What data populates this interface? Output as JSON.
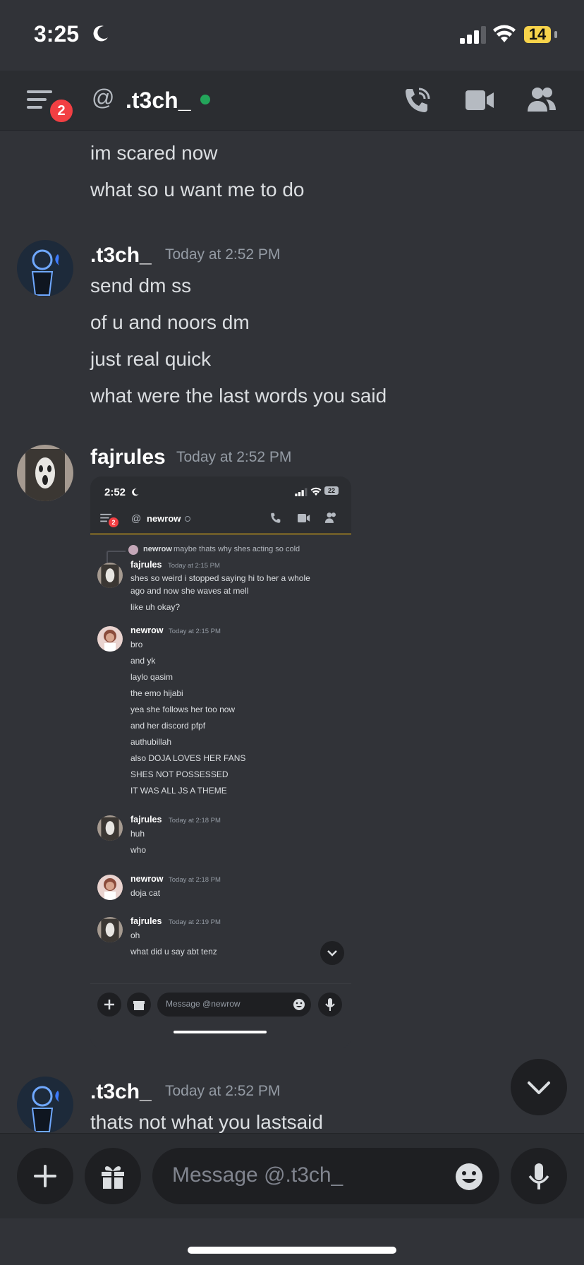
{
  "status_bar": {
    "time": "3:25",
    "battery": "14"
  },
  "header": {
    "at": "@",
    "channel": ".t3ch_",
    "badge": "2"
  },
  "messages": {
    "cont1": "im scared now",
    "cont2": "what so u want me to do",
    "g1": {
      "author": ".t3ch_",
      "time": "Today at 2:52 PM",
      "lines": [
        "send dm ss",
        "of u and noors dm",
        "just real quick",
        "what were the last words you said"
      ]
    },
    "g2": {
      "author": "fajrules",
      "time": "Today at 2:52 PM"
    },
    "g3": {
      "author": ".t3ch_",
      "time": "Today at 2:52 PM",
      "line": "thats not what you lastsaid"
    }
  },
  "screenshot": {
    "time": "2:52",
    "battery": "22",
    "badge": "2",
    "channel": "newrow",
    "reply_author": "newrow",
    "reply_text": "maybe thats why shes acting so cold",
    "m1": {
      "author": "fajrules",
      "time": "Today at 2:15 PM",
      "lines": [
        "shes so weird i stopped saying hi to her a whole",
        "ago and now she waves at mell",
        "like uh okay?"
      ]
    },
    "m2": {
      "author": "newrow",
      "time": "Today at 2:15 PM",
      "lines": [
        "bro",
        "and yk",
        "laylo qasim",
        "the emo hijabi",
        "yea she follows her too now",
        "and her discord pfpf",
        "authubillah",
        "also DOJA LOVES HER FANS",
        "SHES NOT POSSESSED",
        "IT WAS ALL JS A THEME"
      ]
    },
    "m3": {
      "author": "fajrules",
      "time": "Today at 2:18 PM",
      "lines": [
        "huh",
        "who"
      ]
    },
    "m4": {
      "author": "newrow",
      "time": "Today at 2:18 PM",
      "lines": [
        "doja cat"
      ]
    },
    "m5": {
      "author": "fajrules",
      "time": "Today at 2:19 PM",
      "lines": [
        "oh",
        "what did u say abt tenz"
      ]
    },
    "placeholder": "Message @newrow"
  },
  "composer": {
    "placeholder": "Message @.t3ch_"
  },
  "icons": [
    "moon-icon",
    "signal-icon",
    "wifi-icon",
    "battery-icon",
    "menu-icon",
    "at-icon",
    "voice-call-icon",
    "video-call-icon",
    "members-icon",
    "plus-icon",
    "gift-icon",
    "emoji-icon",
    "mic-icon",
    "chevron-down-icon"
  ]
}
